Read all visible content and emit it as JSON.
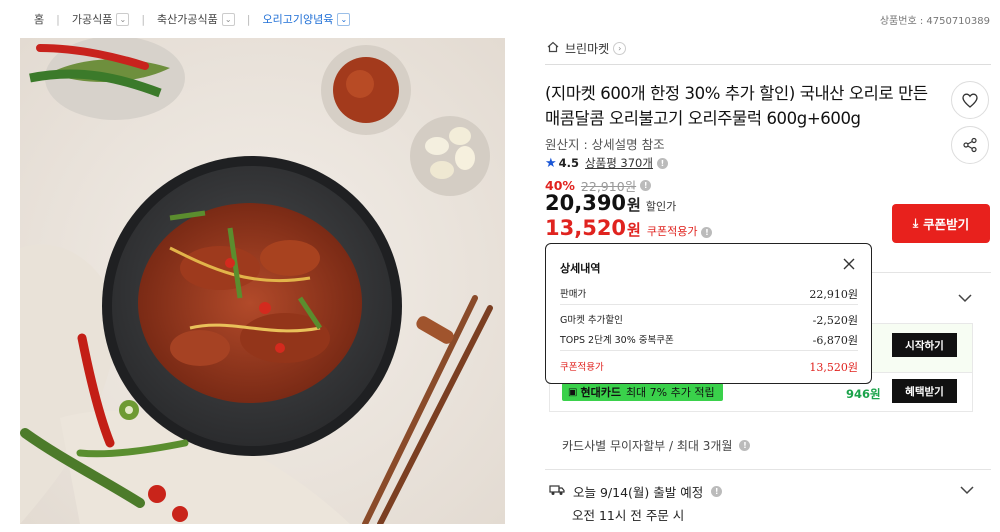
{
  "breadcrumb": [
    {
      "label": "홈",
      "dropdown": false
    },
    {
      "label": "가공식품",
      "dropdown": true
    },
    {
      "label": "축산가공식품",
      "dropdown": true
    },
    {
      "label": "오리고기양념육",
      "dropdown": true
    }
  ],
  "product_no": "상품번호 : 4750710389",
  "store": {
    "name": "브린마켓"
  },
  "title": "(지마켓 600개 한정 30% 추가 할인) 국내산 오리로 만든 매콤달콤 오리불고기 오리주물럭 600g+600g",
  "origin": "원산지 : 상세설명 참조",
  "rating": {
    "score": "4.5",
    "review_label": "상품평 370개"
  },
  "price": {
    "discount_pct": "40%",
    "original": "22,910원",
    "sale": "20,390",
    "sale_unit": "원",
    "sale_label": "할인가",
    "coupon": "13,520",
    "coupon_unit": "원",
    "coupon_label": "쿠폰적용가"
  },
  "coupon_button": "쿠폰받기",
  "popup": {
    "title": "상세내역",
    "rows": [
      {
        "label": "판매가",
        "value": "22,910원"
      },
      {
        "label": "G마켓 추가할인",
        "value": "-2,520원"
      },
      {
        "label": "TOPS 2단계 30% 중복쿠폰",
        "value": "-6,870원"
      }
    ],
    "total": {
      "label": "쿠폰적용가",
      "value": "13,520원"
    }
  },
  "promos": {
    "start_button": "시작하기",
    "card_name": "현대카드",
    "card_text": "최대 7% 추가 적립",
    "points": "946원",
    "benefit_button": "혜택받기"
  },
  "installment": "카드사별 무이자할부 / 최대 3개월",
  "shipping": {
    "line1": "오늘 9/14(월) 출발 예정",
    "line2": "오전 11시 전 주문 시"
  },
  "colors": {
    "accent_red": "#e8211d",
    "rating_blue": "#1a56d6",
    "card_green": "#3ad14b"
  }
}
